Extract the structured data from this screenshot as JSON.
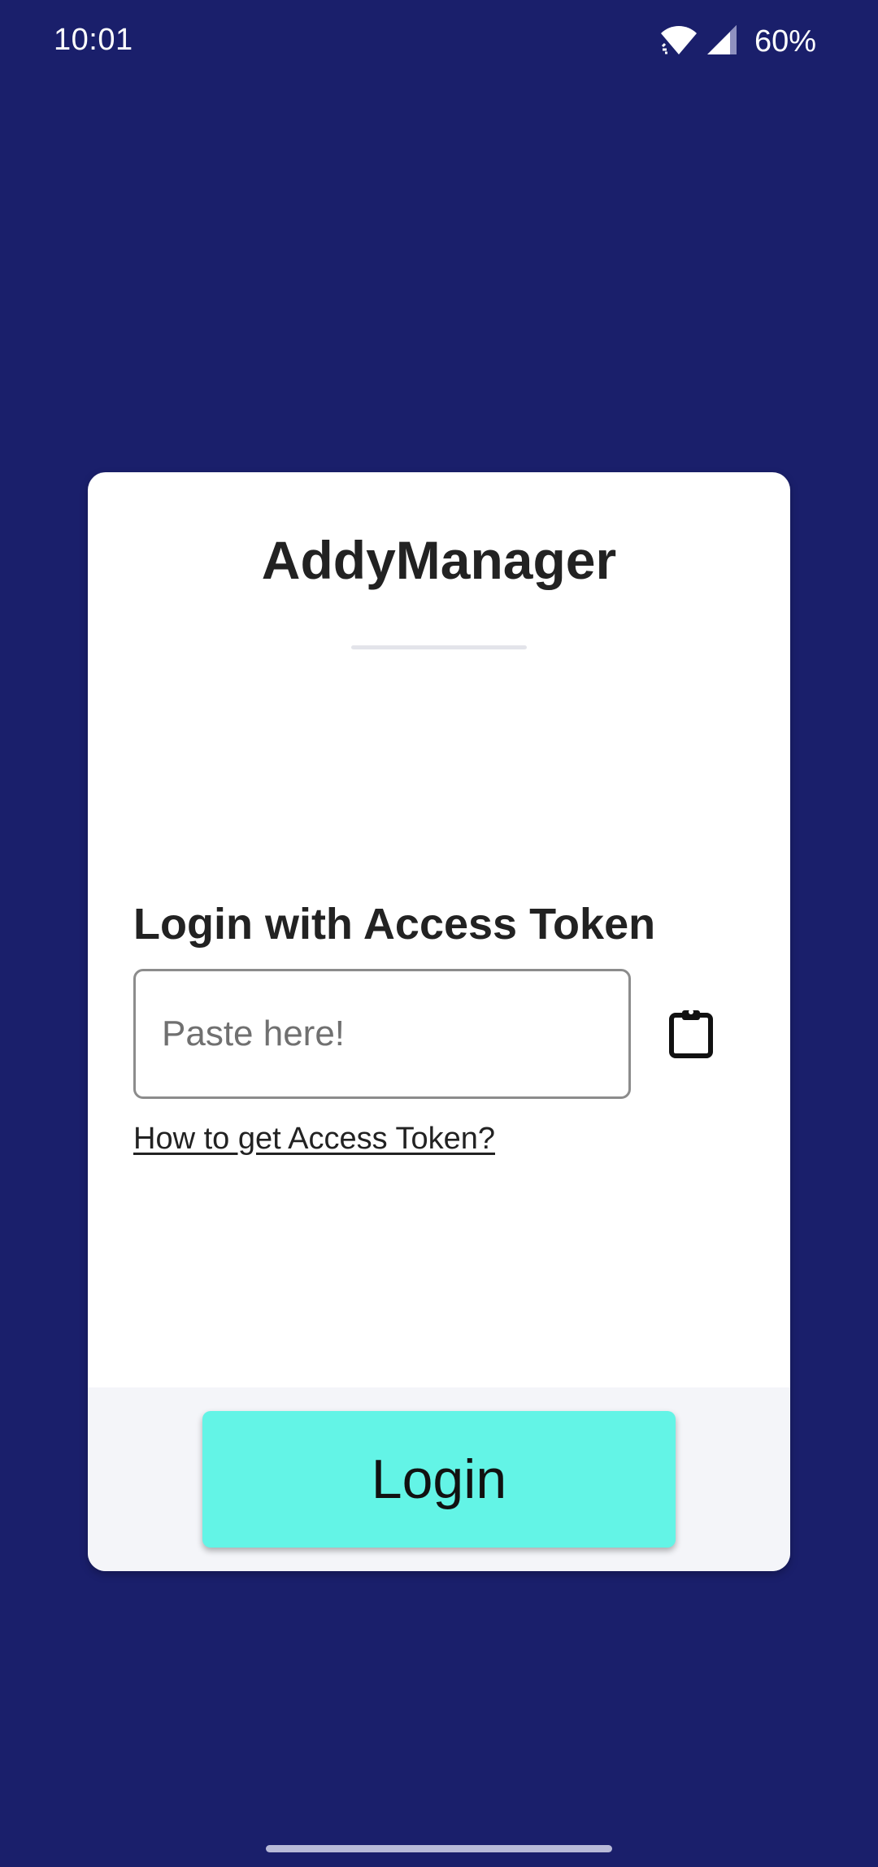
{
  "status_bar": {
    "time": "10:01",
    "battery": "60%",
    "icons": [
      "wifi-icon",
      "cell-signal-icon"
    ]
  },
  "card": {
    "title": "AddyManager",
    "login_heading": "Login with Access Token",
    "token_input": {
      "value": "",
      "placeholder": "Paste here!"
    },
    "paste_icon": "clipboard-icon",
    "help_link": "How to get Access Token?",
    "login_button": "Login"
  },
  "colors": {
    "background": "#1a1f6b",
    "card": "#ffffff",
    "footer": "#f4f5f9",
    "accent": "#63f4e6"
  }
}
